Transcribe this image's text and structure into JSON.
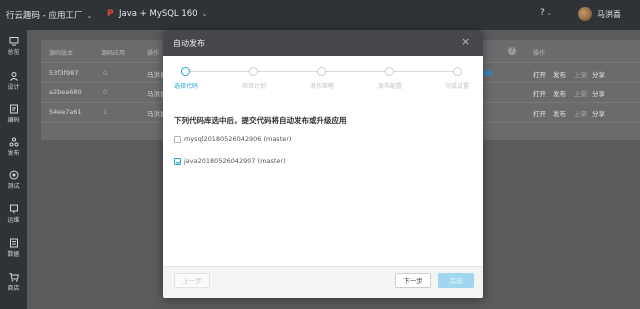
{
  "header": {
    "brand": "行云趣码 - 应用工厂",
    "project": "Java + MySQL 160",
    "help_icon": "help-circle-icon",
    "user_name": "马洪喜"
  },
  "sidebar": {
    "items": [
      {
        "label": "总览",
        "icon": "monitor-icon"
      },
      {
        "label": "设计",
        "icon": "user-design-icon"
      },
      {
        "label": "编码",
        "icon": "code-icon"
      },
      {
        "label": "发布",
        "icon": "publish-icon"
      },
      {
        "label": "测试",
        "icon": "test-icon"
      },
      {
        "label": "运维",
        "icon": "ops-icon"
      },
      {
        "label": "数据",
        "icon": "data-icon"
      },
      {
        "label": "商店",
        "icon": "cart-icon"
      }
    ]
  },
  "table": {
    "headers": [
      "源码版本",
      "源码应用",
      "操作"
    ],
    "rows": [
      {
        "version": "53f3f987",
        "count": "0",
        "actions": [
          "打开",
          "发布",
          "上架",
          "分享"
        ]
      },
      {
        "version": "a2bea680",
        "count": "0",
        "actions": [
          "打开",
          "发布",
          "上架",
          "分享"
        ]
      },
      {
        "version": "54ee7a61",
        "count": "1",
        "actions": [
          "打开",
          "发布",
          "上架",
          "分享"
        ]
      }
    ],
    "truncated_cells": [
      "马洪喜",
      "马洪喜",
      "马洪喜"
    ]
  },
  "modal": {
    "title": "自动发布",
    "steps": [
      "选择代码",
      "项目计划",
      "发布策略",
      "发布配置",
      "完成设置"
    ],
    "active_step": 0,
    "section_title": "下列代码库选中后，提交代码将自动发布或升级应用",
    "options": [
      {
        "label": "mysql20180526042906 (master)",
        "checked": false
      },
      {
        "label": "java20180526042907 (master)",
        "checked": true
      }
    ],
    "buttons": {
      "prev": "上一步",
      "next": "下一步",
      "done": "完成"
    }
  },
  "colors": {
    "accent": "#2aa3d8",
    "topbar": "#2f3236",
    "overlay": "#5a5b5d"
  }
}
